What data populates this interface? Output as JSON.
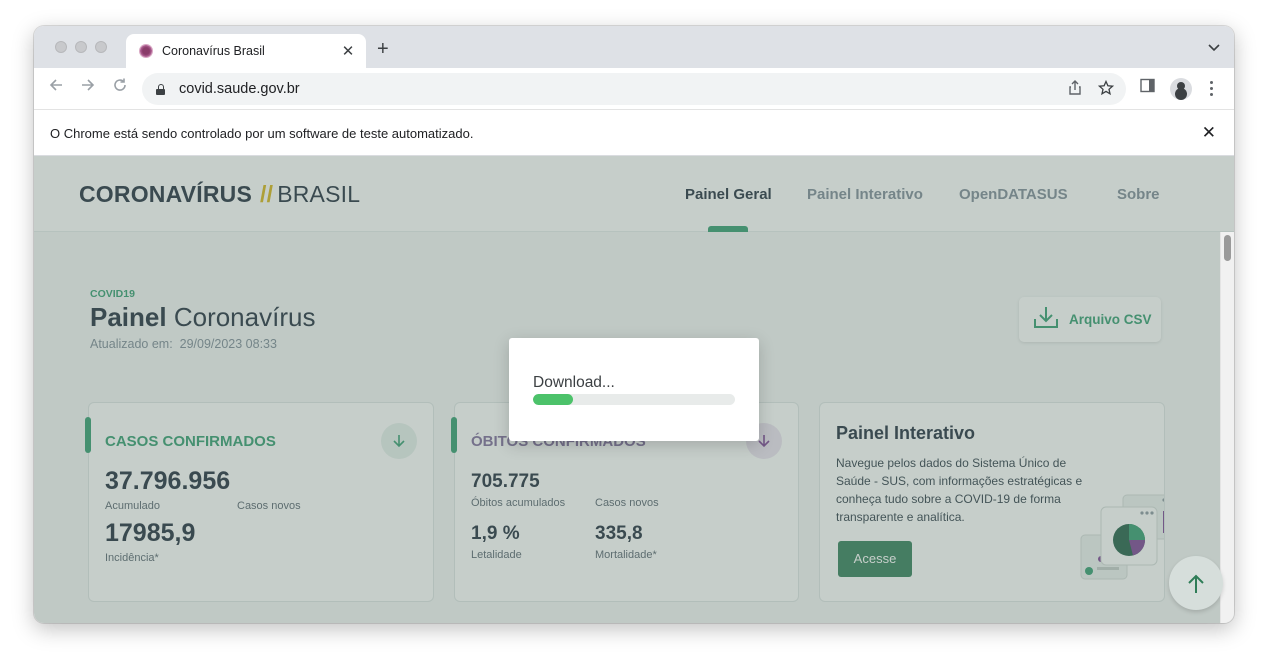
{
  "browser": {
    "tab_title": "Coronavírus Brasil",
    "tab_close": "✕",
    "new_tab": "+",
    "url": "covid.saude.gov.br",
    "infobar_text": "O Chrome está sendo controlado por um software de teste automatizado.",
    "infobar_close": "✕"
  },
  "header": {
    "logo_strong": "CORONAVÍRUS",
    "logo_slash": "//",
    "logo_light": "BRASIL",
    "nav": [
      "Painel Geral",
      "Painel Interativo",
      "OpenDATASUS",
      "Sobre"
    ]
  },
  "main": {
    "tag": "COVID19",
    "title_strong": "Painel",
    "title_rest": "Coronavírus",
    "updated_label": "Atualizado em:",
    "updated_value": "29/09/2023 08:33",
    "csv_label": "Arquivo CSV"
  },
  "cards": {
    "casos": {
      "title": "CASOS CONFIRMADOS",
      "accumulated_value": "37.796.956",
      "accumulated_label": "Acumulado",
      "new_label": "Casos novos",
      "incidence_value": "17985,9",
      "incidence_label": "Incidência*"
    },
    "obitos": {
      "title": "ÓBITOS CONFIRMADOS",
      "accumulated_value": "705.775",
      "accumulated_label": "Óbitos acumulados",
      "new_label": "Casos novos",
      "lethality_value": "1,9 %",
      "lethality_label": "Letalidade",
      "mortality_value": "335,8",
      "mortality_label": "Mortalidade*"
    },
    "painel": {
      "title": "Painel Interativo",
      "description": "Navegue pelos dados do Sistema Único de Saúde - SUS, com informações estratégicas e conheça tudo sobre a COVID-19 de forma transparente e analítica.",
      "button": "Acesse"
    }
  },
  "modal": {
    "text": "Download...",
    "progress_fraction": 0.2
  },
  "colors": {
    "accent_green": "#2f9c6f",
    "dark_green_button": "#2f7d57",
    "progress_green": "#4cc26a",
    "logo_yellow": "#d7b313"
  },
  "icons": {
    "back": "arrow-left-icon",
    "forward": "arrow-right-icon",
    "reload": "reload-icon",
    "share": "share-icon",
    "bookmark": "star-icon",
    "sidepanel": "side-panel-icon",
    "profile": "profile-icon",
    "menu": "kebab-menu-icon",
    "csv": "download-icon",
    "scroll_top": "arrow-up-icon"
  }
}
